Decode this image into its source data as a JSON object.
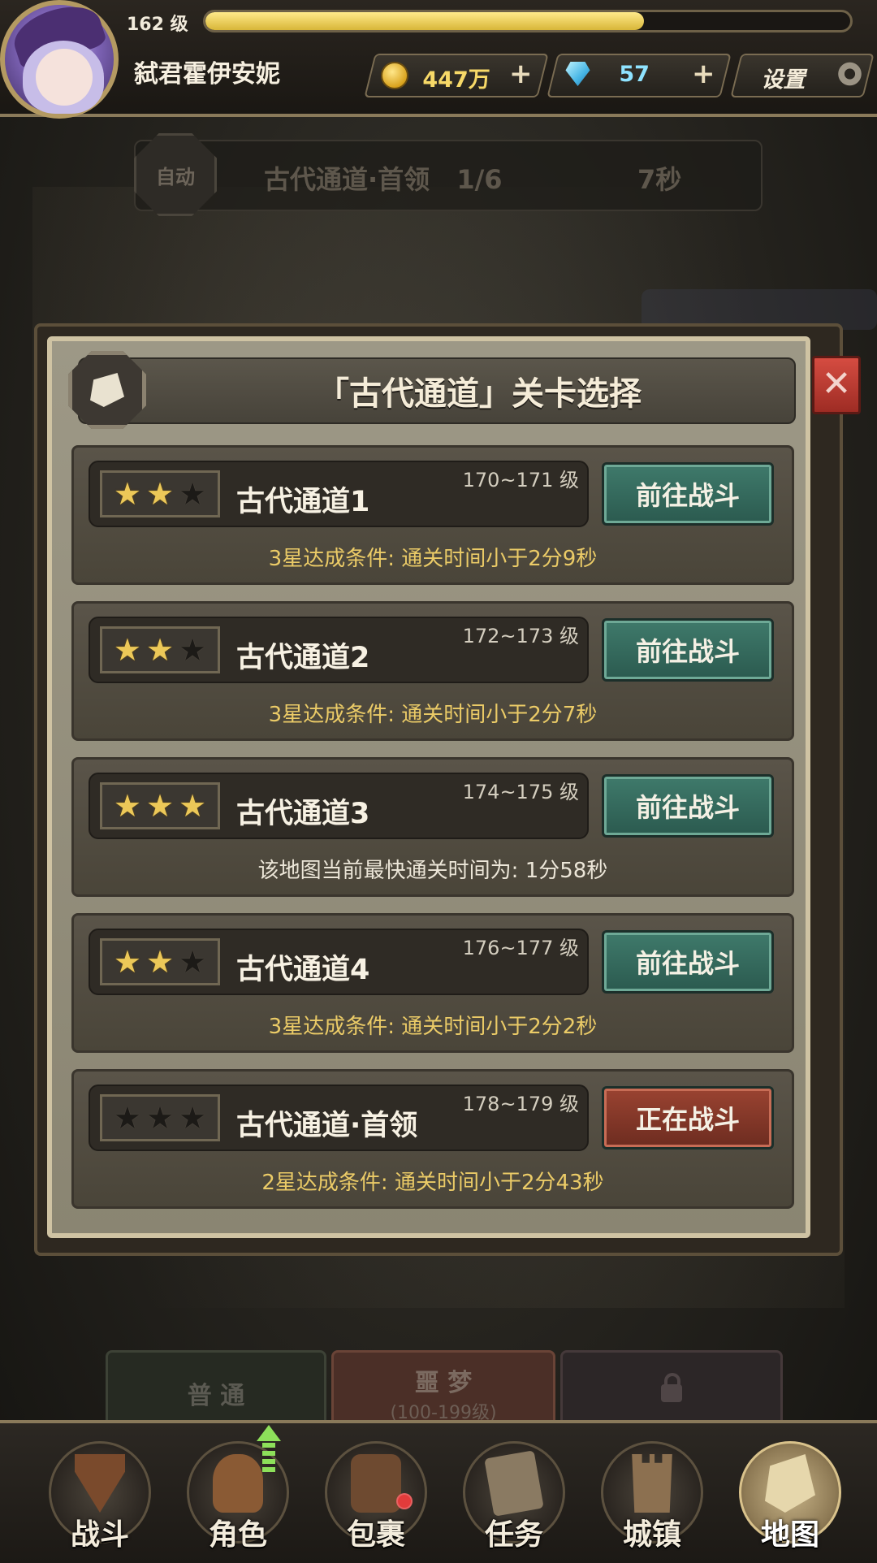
{
  "player": {
    "level_text": "162 级",
    "name": "弑君霍伊安妮",
    "xp_fraction": 0.68
  },
  "resources": {
    "gold": "447万",
    "gems": "57",
    "plus_symbol": "+",
    "settings_label": "设置"
  },
  "auto_panel": {
    "auto_label": "自动",
    "stage_text": "古代通道·首领",
    "progress": "1/6",
    "timer": "7秒"
  },
  "modal": {
    "title": "「古代通道」关卡选择",
    "close_symbol": "✕"
  },
  "stages": [
    {
      "stars": 2,
      "name": "古代通道1",
      "level_range": "170~171 级",
      "button": "前往战斗",
      "active": false,
      "condition": "3星达成条件:  通关时间小于2分9秒",
      "condition_style": "gold"
    },
    {
      "stars": 2,
      "name": "古代通道2",
      "level_range": "172~173 级",
      "button": "前往战斗",
      "active": false,
      "condition": "3星达成条件:  通关时间小于2分7秒",
      "condition_style": "gold"
    },
    {
      "stars": 3,
      "name": "古代通道3",
      "level_range": "174~175 级",
      "button": "前往战斗",
      "active": false,
      "condition": "该地图当前最快通关时间为:  1分58秒",
      "condition_style": "white"
    },
    {
      "stars": 2,
      "name": "古代通道4",
      "level_range": "176~177 级",
      "button": "前往战斗",
      "active": false,
      "condition": "3星达成条件:  通关时间小于2分2秒",
      "condition_style": "gold"
    },
    {
      "stars": 0,
      "name": "古代通道·首领",
      "level_range": "178~179 级",
      "button": "正在战斗",
      "active": true,
      "condition": "2星达成条件:  通关时间小于2分43秒",
      "condition_style": "gold"
    }
  ],
  "difficulty_tabs": {
    "normal": "普 通",
    "nightmare": "噩 梦",
    "nightmare_range": "(100-199级)"
  },
  "nav": {
    "items": [
      {
        "label": "战斗",
        "icon": "battle-shield-icon"
      },
      {
        "label": "角色",
        "icon": "helmet-icon"
      },
      {
        "label": "包裹",
        "icon": "backpack-icon"
      },
      {
        "label": "任务",
        "icon": "quest-scroll-icon"
      },
      {
        "label": "城镇",
        "icon": "tower-icon"
      },
      {
        "label": "地图",
        "icon": "map-icon"
      }
    ],
    "selected": "地图"
  },
  "colors": {
    "accent_gold": "#ecc858",
    "fight_button": "#3f7a6b",
    "active_button": "#9a4331"
  }
}
